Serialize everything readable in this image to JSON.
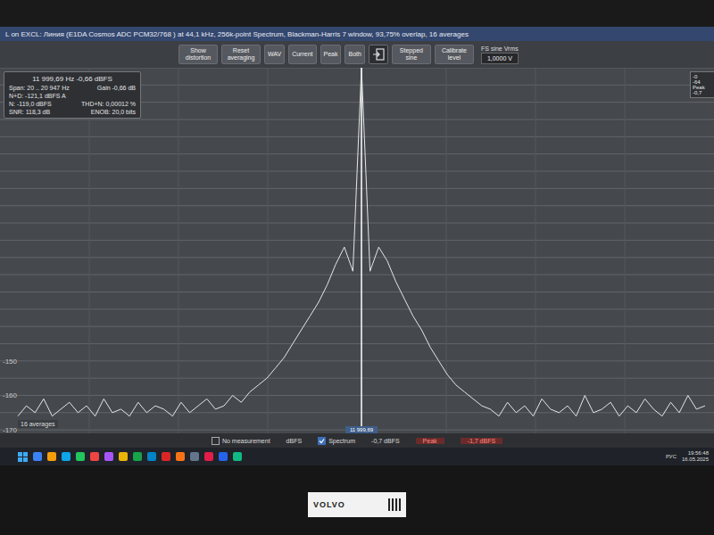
{
  "window": {
    "title": "L on EXCL: Линия (E1DA Cosmos ADC PCM32/768 ) at 44,1 kHz, 256k-point Spectrum, Blackman-Harris 7 window, 93,75% overlap, 16 averages"
  },
  "toolbar": {
    "buttons": [
      {
        "label": "Show distortion",
        "kind": "text"
      },
      {
        "label": "Reset averaging",
        "kind": "text"
      },
      {
        "label": "WAV",
        "kind": "text"
      },
      {
        "label": "Current",
        "kind": "text"
      },
      {
        "label": "Peak",
        "kind": "text"
      },
      {
        "label": "Both",
        "kind": "text"
      },
      {
        "kind": "icon"
      },
      {
        "label": "Stepped sine",
        "kind": "text"
      },
      {
        "label": "Calibrate level",
        "kind": "text"
      }
    ],
    "field": {
      "label": "FS sine Vrms",
      "value": "1,0000 V"
    }
  },
  "info_box": {
    "header": "11 999,69 Hz  -0,66 dBFS",
    "rows": [
      {
        "left": "Span: 20 .. 20 947 Hz",
        "right": "Gain -0,66 dB"
      },
      {
        "left": "N+D: -121,1 dBFS A",
        "right": ""
      },
      {
        "left": "N: -119,0 dBFS",
        "right": "THD+N: 0,00012 %"
      },
      {
        "left": "SNR: 118,3 dB",
        "right": "ENOB: 20,0 bits"
      }
    ]
  },
  "side_box": {
    "lines": [
      "-0",
      "-64",
      "Peak",
      "-0,7"
    ]
  },
  "chart": {
    "averages_label": "16 averages",
    "cursor_label": "11 999,69",
    "y_ticks": [
      {
        "label": "-150",
        "value": -150
      },
      {
        "label": "-160",
        "value": -160
      },
      {
        "label": "-170",
        "value": -170
      }
    ],
    "series": [
      {
        "name": "Spectrum",
        "values": [
          -166,
          -163,
          -165,
          -161,
          -166,
          -164,
          -162,
          -165,
          -163,
          -166,
          -161,
          -165,
          -164,
          -166,
          -162,
          -165,
          -163,
          -164,
          -166,
          -162,
          -165,
          -163,
          -161,
          -164,
          -163,
          -160,
          -162,
          -159,
          -157,
          -155,
          -152,
          -149,
          -145,
          -141,
          -137,
          -133,
          -128,
          -122,
          -117,
          -124,
          -0.66,
          -124,
          -117,
          -121,
          -127,
          -132,
          -137,
          -141,
          -146,
          -150,
          -154,
          -157,
          -159,
          -161,
          -163,
          -164,
          -166,
          -162,
          -165,
          -163,
          -166,
          -161,
          -164,
          -165,
          -163,
          -166,
          -160,
          -165,
          -164,
          -162,
          -166,
          -163,
          -165,
          -161,
          -164,
          -166,
          -162,
          -165,
          -160,
          -164,
          -163
        ]
      }
    ]
  },
  "bottom_bar": {
    "items": [
      {
        "label": "No measurement",
        "kind": "check",
        "checked": false
      },
      {
        "label": "dBFS",
        "kind": "text"
      },
      {
        "label": "Spectrum",
        "kind": "check",
        "checked": true
      },
      {
        "label": "-0,7 dBFS",
        "kind": "text"
      },
      {
        "label": "Peak",
        "kind": "alert"
      },
      {
        "label": "-1,7 dBFS",
        "kind": "alert"
      }
    ]
  },
  "taskbar": {
    "language": "РУС",
    "time": "19:56:48",
    "date": "16.05.2025"
  },
  "bezel": {
    "sticker": "VOLVO"
  }
}
